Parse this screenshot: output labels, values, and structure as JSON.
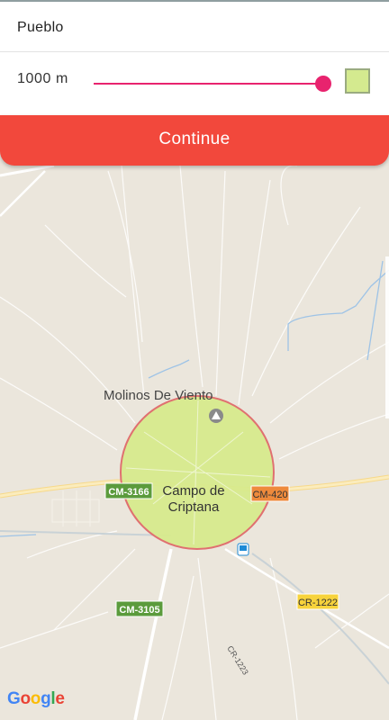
{
  "form": {
    "name_value": "Pueblo",
    "radius_value": "1000 m",
    "slider_fraction": 1.0,
    "swatch_color": "#d4ea8f"
  },
  "action": {
    "continue_label": "Continue"
  },
  "map": {
    "place_label": "Molinos De Viento",
    "town_label_line1": "Campo de",
    "town_label_line2": "Criptana",
    "road_cm3166": "CM-3166",
    "road_cm420": "CM-420",
    "road_cm3105": "CM-3105",
    "road_cr1222": "CR-1222",
    "road_cr1223": "CR-1223",
    "google_letters": [
      "G",
      "o",
      "o",
      "g",
      "l",
      "e"
    ],
    "google_colors": [
      "#4285F4",
      "#EA4335",
      "#FBBC05",
      "#4285F4",
      "#34A853",
      "#EA4335"
    ],
    "circle_fill": "#d7ea8c",
    "circle_stroke": "#e07070",
    "accent": "#e8236e",
    "button_color": "#f2483c"
  }
}
